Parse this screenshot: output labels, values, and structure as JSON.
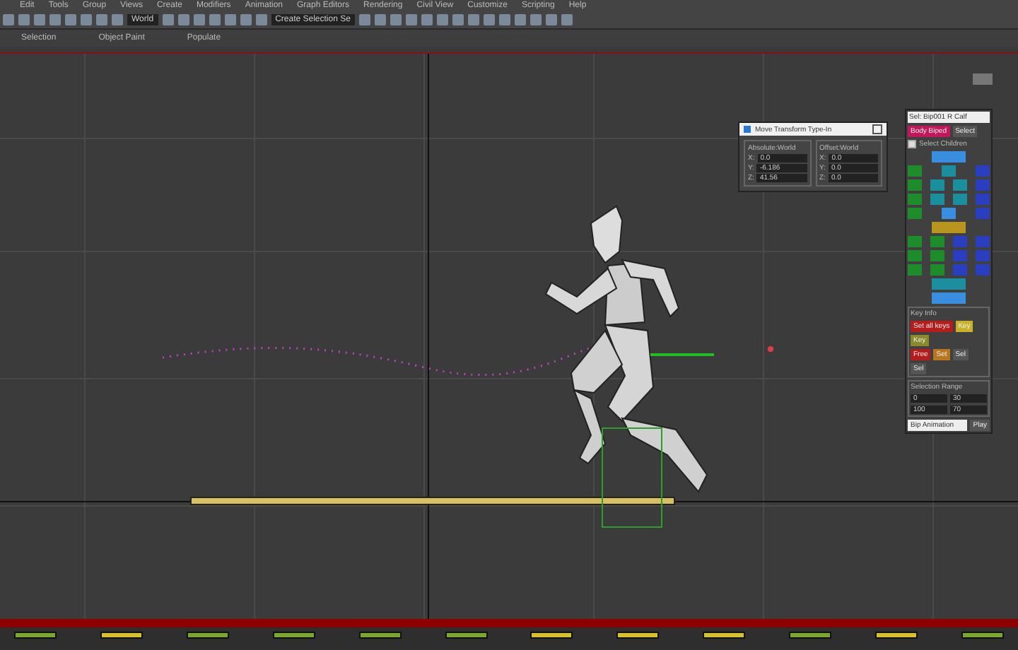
{
  "menu": [
    "Edit",
    "Tools",
    "Group",
    "Views",
    "Create",
    "Modifiers",
    "Animation",
    "Graph Editors",
    "Rendering",
    "Civil View",
    "Customize",
    "Scripting",
    "Help"
  ],
  "toolbar": {
    "coord_system": "World",
    "selection_set": "Create Selection Se"
  },
  "ribbon_tabs": [
    {
      "label": "Selection",
      "selected": false
    },
    {
      "label": "Object Paint",
      "selected": false
    },
    {
      "label": "Populate",
      "selected": false
    }
  ],
  "transform_dialog": {
    "title": "Move Transform Type-In",
    "groups": [
      {
        "title": "Absolute:World",
        "fields": [
          {
            "axis": "X:",
            "value": "0.0"
          },
          {
            "axis": "Y:",
            "value": "-6.186"
          },
          {
            "axis": "Z:",
            "value": "41.56"
          }
        ]
      },
      {
        "title": "Offset:World",
        "fields": [
          {
            "axis": "X:",
            "value": "0.0"
          },
          {
            "axis": "Y:",
            "value": "0.0"
          },
          {
            "axis": "Z:",
            "value": "0.0"
          }
        ]
      }
    ]
  },
  "biped_panel": {
    "title": "Sel: Bip001 R Calf",
    "top_buttons": [
      {
        "label": "Body Biped",
        "color": "#c2185b"
      },
      {
        "label": "Select",
        "color": "#555555"
      }
    ],
    "option": {
      "label": "Select Children",
      "checked": true
    },
    "picker_rows": [
      [
        {
          "color": "#3a8ee0",
          "wide": true
        }
      ],
      [
        {
          "color": "#1e8c2a"
        },
        {
          "color": "#1b8ea0"
        },
        {
          "color": "#2a3ec0"
        }
      ],
      [
        {
          "color": "#1e8c2a"
        },
        {
          "color": "#1b8ea0"
        },
        {
          "color": "#1b8ea0"
        },
        {
          "color": "#2a3ec0"
        }
      ],
      [
        {
          "color": "#1e8c2a"
        },
        {
          "color": "#1b8ea0"
        },
        {
          "color": "#1b8ea0"
        },
        {
          "color": "#2a3ec0"
        }
      ],
      [
        {
          "color": "#1e8c2a"
        },
        {
          "color": "#3a8ee0"
        },
        {
          "color": "#2a3ec0"
        }
      ],
      [
        {
          "color": "#b8961e",
          "wide": true
        }
      ],
      [
        {
          "color": "#1e8c2a"
        },
        {
          "color": "#1e8c2a"
        },
        {
          "color": "#2a3ec0"
        },
        {
          "color": "#2a3ec0"
        }
      ],
      [
        {
          "color": "#1e8c2a"
        },
        {
          "color": "#1e8c2a"
        },
        {
          "color": "#2a3ec0"
        },
        {
          "color": "#2a3ec0"
        }
      ],
      [
        {
          "color": "#1e8c2a"
        },
        {
          "color": "#1e8c2a"
        },
        {
          "color": "#2a3ec0"
        },
        {
          "color": "#2a3ec0"
        }
      ],
      [
        {
          "color": "#1b8ea0",
          "wide": true
        }
      ],
      [
        {
          "color": "#3a8ee0",
          "wide": true
        }
      ]
    ],
    "key_section": {
      "title": "Key Info",
      "buttons": [
        {
          "label": "Set all keys",
          "color": "#b71c1c"
        },
        {
          "label": "Key",
          "color": "#c9b22a"
        },
        {
          "label": "Key",
          "color": "#8a8a2a"
        }
      ],
      "row2": [
        {
          "label": "Free",
          "color": "#b71c1c"
        },
        {
          "label": "Set",
          "color": "#b8761e"
        },
        {
          "label": "Sel",
          "color": "#555555"
        },
        {
          "label": "Sel",
          "color": "#555555"
        }
      ]
    },
    "range_section": {
      "title": "Selection Range",
      "fields": [
        "0",
        "30",
        "100",
        "70"
      ]
    },
    "mode": "Bip Animation",
    "mode_button": "Play"
  },
  "time_slider": {
    "level": 1
  },
  "keys": [
    {
      "color": "#7aa82a"
    },
    {
      "color": "#d8c22a"
    },
    {
      "color": "#7aa82a"
    },
    {
      "color": "#7aa82a"
    },
    {
      "color": "#7aa82a"
    },
    {
      "color": "#7aa82a"
    },
    {
      "color": "#d8c22a"
    },
    {
      "color": "#d8c22a"
    },
    {
      "color": "#d8c22a"
    },
    {
      "color": "#7aa82a"
    },
    {
      "color": "#d8c22a"
    },
    {
      "color": "#7aa82a"
    }
  ]
}
